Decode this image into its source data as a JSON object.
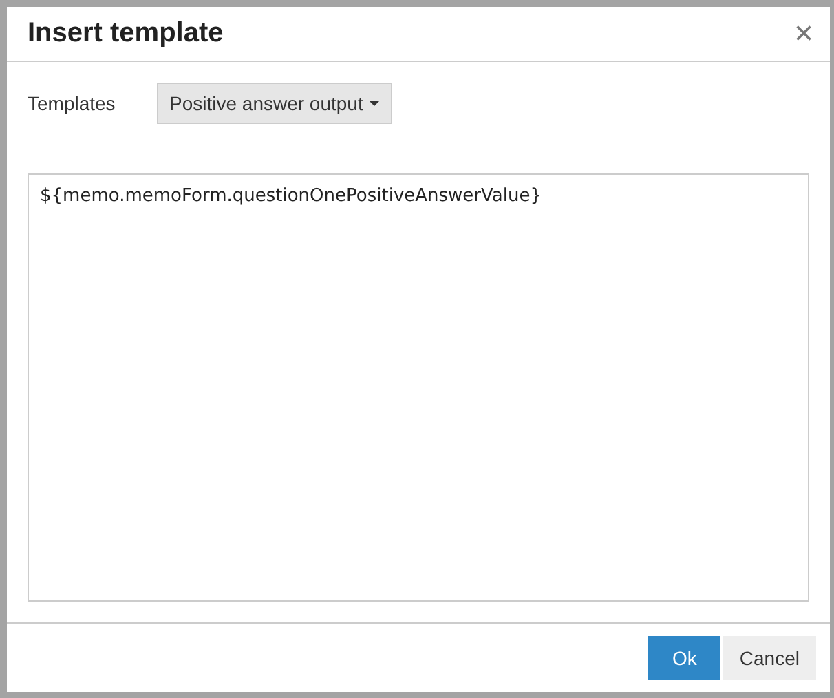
{
  "dialog": {
    "title": "Insert template",
    "close": "×"
  },
  "templates": {
    "label": "Templates",
    "selected_template": "Positive answer output"
  },
  "editor": {
    "value": "${memo.memoForm.questionOnePositiveAnswerValue}"
  },
  "buttons": [
    {
      "label": "Ok",
      "kind": "primary"
    },
    {
      "label": "Cancel",
      "kind": "secondary"
    }
  ]
}
